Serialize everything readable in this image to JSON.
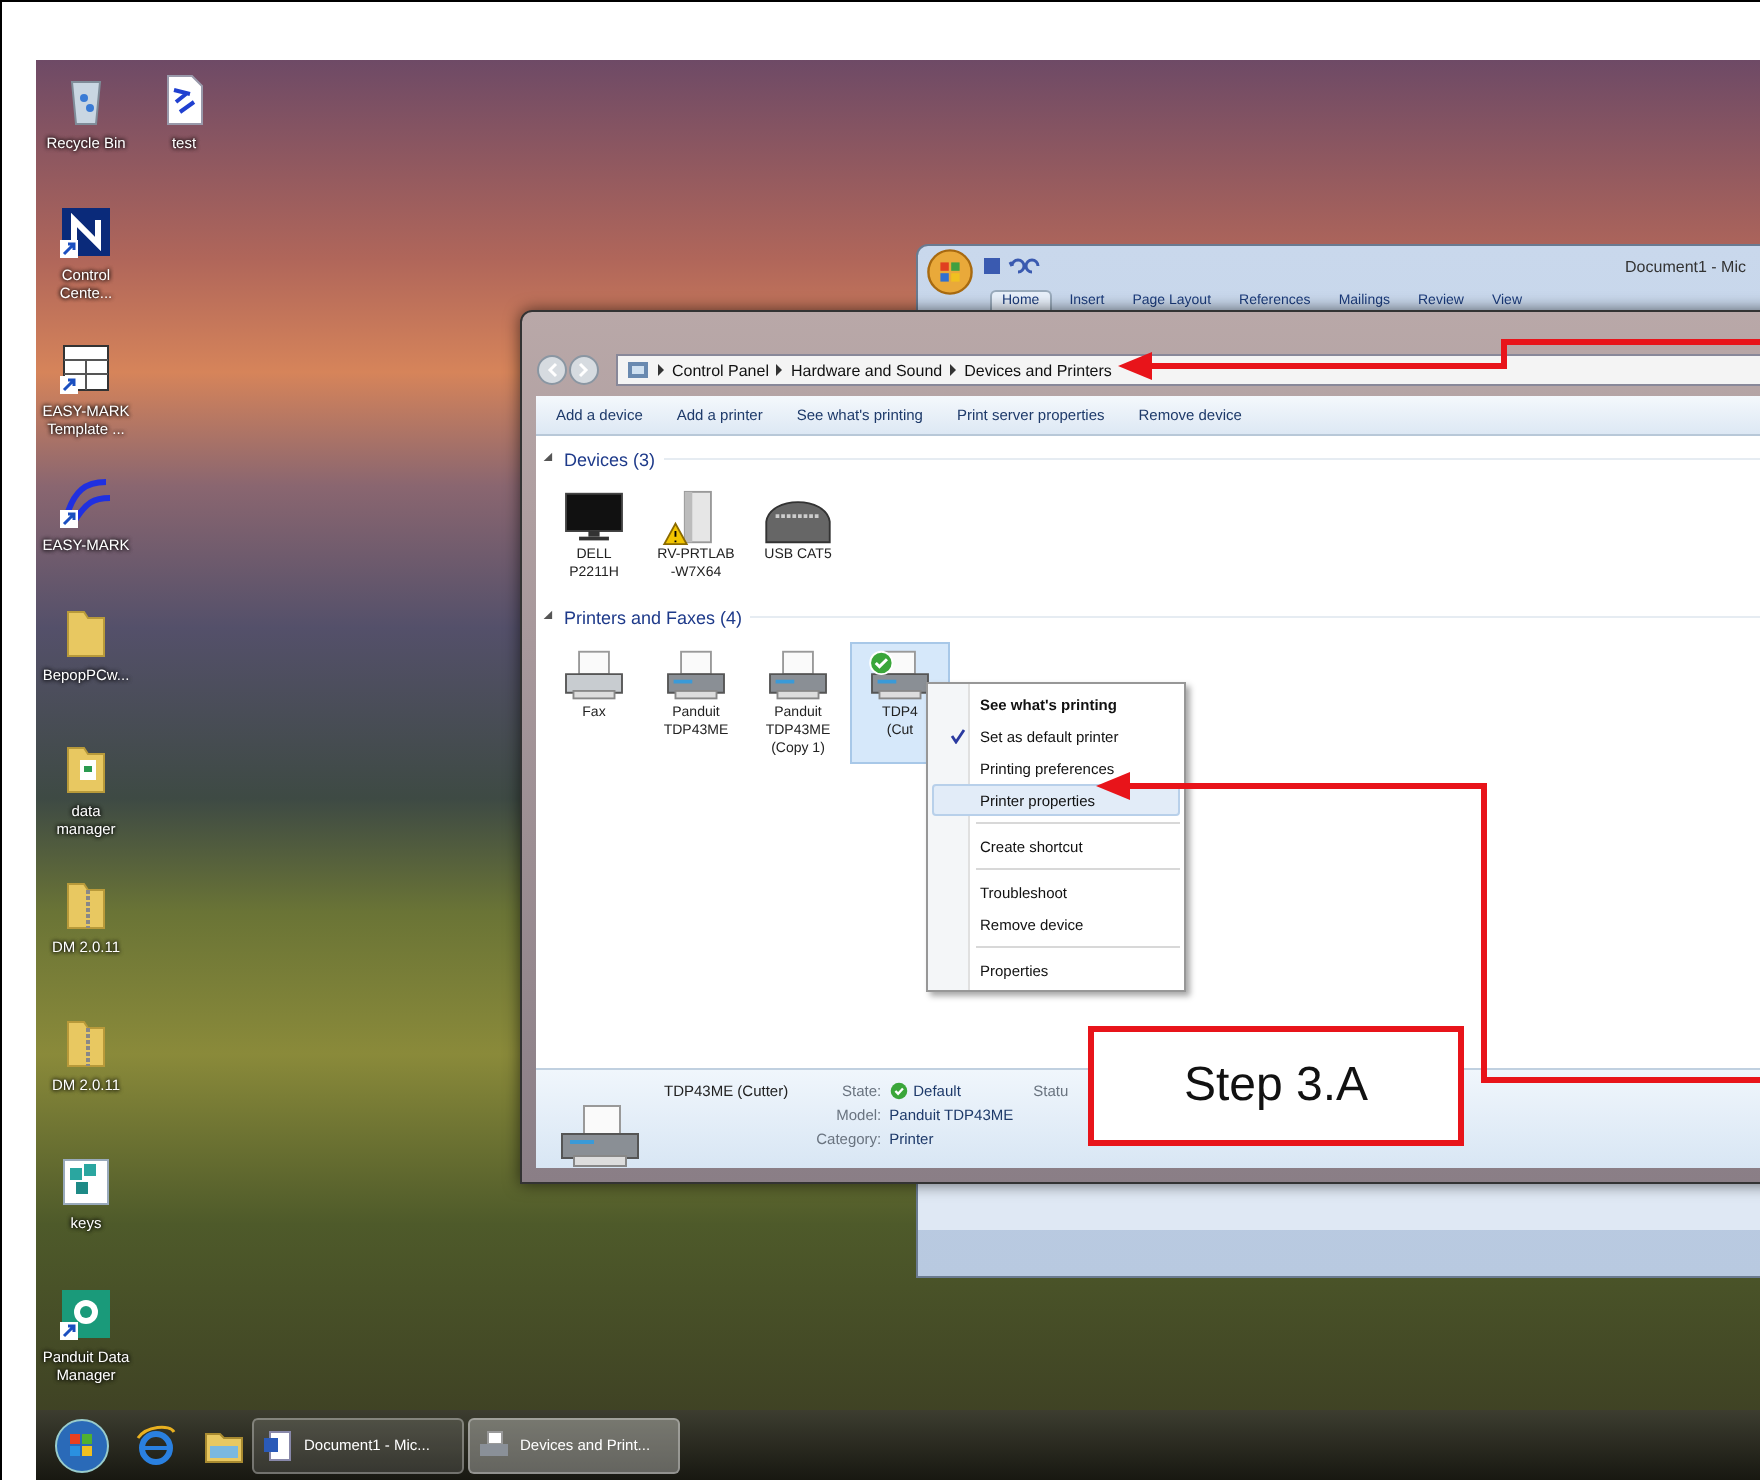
{
  "desktop": {
    "icons": [
      {
        "kind": "recycle-bin",
        "lines": [
          "Recycle Bin"
        ],
        "shortcut": false
      },
      {
        "kind": "document",
        "lines": [
          "test"
        ],
        "shortcut": false
      },
      {
        "kind": "app-square",
        "lines": [
          "Control",
          "Cente..."
        ],
        "shortcut": true
      },
      {
        "kind": "template",
        "lines": [
          "EASY-MARK",
          "Template ..."
        ],
        "shortcut": true
      },
      {
        "kind": "app-swoosh",
        "lines": [
          "EASY-MARK"
        ],
        "shortcut": true
      },
      {
        "kind": "folder",
        "lines": [
          "BepopPCw..."
        ],
        "shortcut": false
      },
      {
        "kind": "folder-document",
        "lines": [
          "data",
          "manager"
        ],
        "shortcut": false
      },
      {
        "kind": "zip-folder",
        "lines": [
          "DM 2.0.11"
        ],
        "shortcut": false
      },
      {
        "kind": "zip-folder",
        "lines": [
          "DM 2.0.11"
        ],
        "shortcut": false
      },
      {
        "kind": "cubes",
        "lines": [
          "keys"
        ],
        "shortcut": false
      },
      {
        "kind": "app-green",
        "lines": [
          "Panduit Data",
          "Manager"
        ],
        "shortcut": true
      }
    ]
  },
  "word_window": {
    "title": "Document1 - Mic",
    "ribbon_tabs": [
      {
        "label": "Home",
        "selected": true
      },
      {
        "label": "Insert",
        "selected": false
      },
      {
        "label": "Page Layout",
        "selected": false
      },
      {
        "label": "References",
        "selected": false
      },
      {
        "label": "Mailings",
        "selected": false
      },
      {
        "label": "Review",
        "selected": false
      },
      {
        "label": "View",
        "selected": false
      }
    ]
  },
  "explorer_window": {
    "address": [
      "Control Panel",
      "Hardware and Sound",
      "Devices and Printers"
    ],
    "toolbar": [
      "Add a device",
      "Add a printer",
      "See what's printing",
      "Print server properties",
      "Remove device"
    ],
    "groups": [
      {
        "title": "Devices (3)",
        "expanded": true,
        "items": [
          {
            "kind": "monitor",
            "lines": [
              "DELL",
              "P2211H"
            ],
            "warning": false,
            "selected": false
          },
          {
            "kind": "computer",
            "lines": [
              "RV-PRTLAB",
              "-W7X64"
            ],
            "warning": true,
            "selected": false
          },
          {
            "kind": "usb-device",
            "lines": [
              "USB CAT5"
            ],
            "warning": false,
            "selected": false
          }
        ]
      },
      {
        "title": "Printers and Faxes (4)",
        "expanded": true,
        "items": [
          {
            "kind": "fax",
            "lines": [
              "Fax"
            ],
            "warning": false,
            "default": false,
            "selected": false
          },
          {
            "kind": "printer",
            "lines": [
              "Panduit",
              "TDP43ME"
            ],
            "warning": false,
            "default": false,
            "selected": false
          },
          {
            "kind": "printer",
            "lines": [
              "Panduit",
              "TDP43ME",
              "(Copy 1)"
            ],
            "warning": false,
            "default": false,
            "selected": false
          },
          {
            "kind": "printer",
            "lines": [
              "TDP4",
              "(Cut"
            ],
            "warning": false,
            "default": true,
            "selected": true
          }
        ]
      }
    ],
    "details": {
      "name": "TDP43ME (Cutter)",
      "fields": [
        {
          "label": "State:",
          "value": "Default",
          "kind": "status"
        },
        {
          "label": "Model:",
          "value": "Panduit TDP43ME",
          "kind": "text"
        },
        {
          "label": "Category:",
          "value": "Printer",
          "kind": "text"
        }
      ],
      "status_label": "Statu"
    }
  },
  "context_menu": [
    {
      "kind": "item",
      "label": "See what's printing",
      "bold": true,
      "checked": false,
      "selected": false
    },
    {
      "kind": "item",
      "label": "Set as default printer",
      "bold": false,
      "checked": true,
      "selected": false
    },
    {
      "kind": "item",
      "label": "Printing preferences",
      "bold": false,
      "checked": false,
      "selected": false
    },
    {
      "kind": "item",
      "label": "Printer properties",
      "bold": false,
      "checked": false,
      "selected": true
    },
    {
      "kind": "separator"
    },
    {
      "kind": "item",
      "label": "Create shortcut",
      "bold": false,
      "checked": false,
      "selected": false
    },
    {
      "kind": "separator"
    },
    {
      "kind": "item",
      "label": "Troubleshoot",
      "bold": false,
      "checked": false,
      "selected": false
    },
    {
      "kind": "item",
      "label": "Remove device",
      "bold": false,
      "checked": false,
      "selected": false
    },
    {
      "kind": "separator"
    },
    {
      "kind": "item",
      "label": "Properties",
      "bold": false,
      "checked": false,
      "selected": false
    }
  ],
  "callout": {
    "label": "Step 3.A"
  },
  "taskbar": {
    "buttons": [
      {
        "kind": "word",
        "label": "Document1 - Mic...",
        "selected": false
      },
      {
        "kind": "printer",
        "label": "Devices and Print...",
        "selected": true
      }
    ]
  }
}
